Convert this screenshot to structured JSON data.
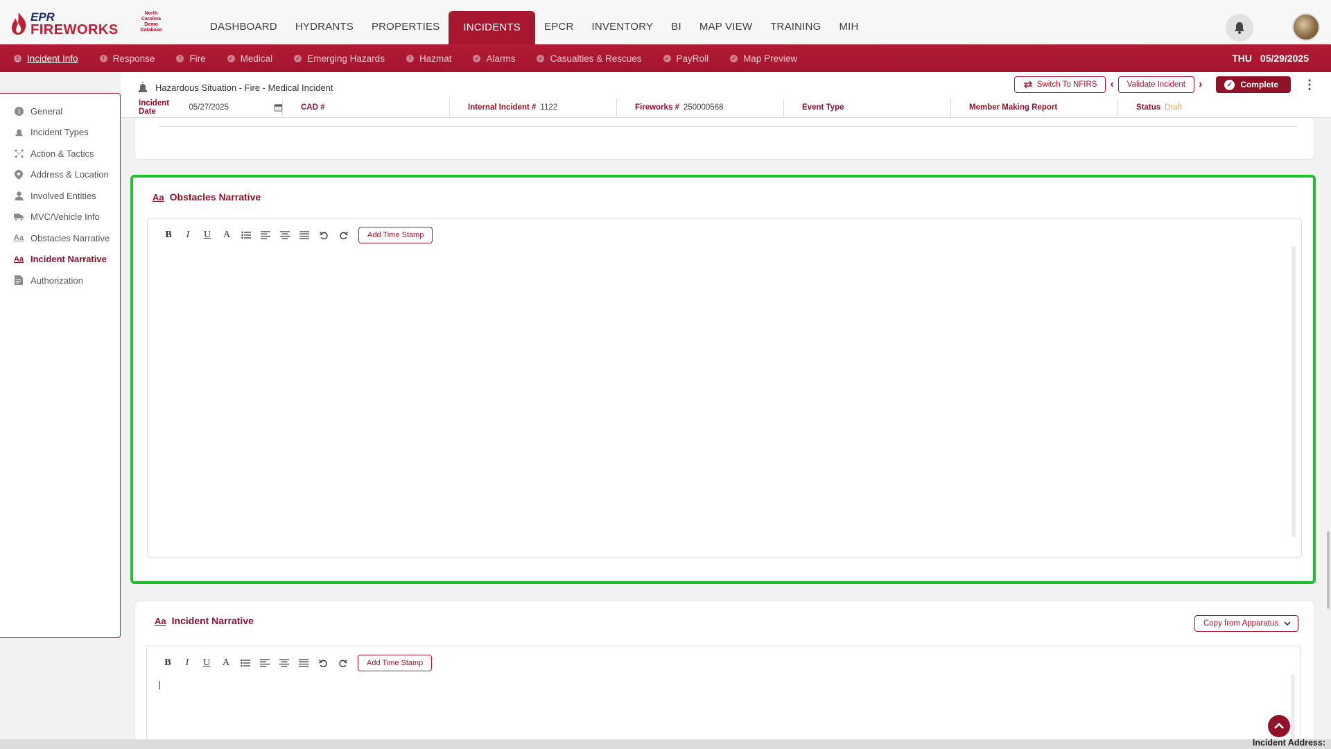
{
  "brand": {
    "logo_line1": "EPR",
    "logo_line2": "FIREWORKS",
    "org_badge": [
      "North",
      "Carolina",
      "Demo",
      "Database"
    ]
  },
  "main_nav": [
    "DASHBOARD",
    "HYDRANTS",
    "PROPERTIES",
    "INCIDENTS",
    "EPCR",
    "INVENTORY",
    "BI",
    "MAP VIEW",
    "TRAINING",
    "MIH"
  ],
  "main_nav_active": "INCIDENTS",
  "sub_nav": {
    "items": [
      {
        "label": "Incident Info",
        "status": "alert"
      },
      {
        "label": "Response",
        "status": "alert"
      },
      {
        "label": "Fire",
        "status": "alert"
      },
      {
        "label": "Medical",
        "status": "check"
      },
      {
        "label": "Emerging Hazards",
        "status": "check"
      },
      {
        "label": "Hazmat",
        "status": "alert"
      },
      {
        "label": "Alarms",
        "status": "check"
      },
      {
        "label": "Casualties & Rescues",
        "status": "check"
      },
      {
        "label": "PayRoll",
        "status": "check"
      },
      {
        "label": "Map Preview",
        "status": "check"
      }
    ],
    "day": "THU",
    "date": "05/29/2025"
  },
  "incident_header": {
    "title": "Hazardous Situation - Fire - Medical Incident",
    "switch_btn": "Switch To NFIRS",
    "validate_btn": "Validate Incident",
    "complete_btn": "Complete",
    "fields": [
      {
        "label": "Incident Date",
        "value": "05/27/2025"
      },
      {
        "label": "CAD #",
        "value": ""
      },
      {
        "label": "Internal Incident #",
        "value": "1122"
      },
      {
        "label": "Fireworks #",
        "value": "250000568"
      },
      {
        "label": "Event Type",
        "value": ""
      },
      {
        "label": "Member Making Report",
        "value": ""
      },
      {
        "label": "Status",
        "value": "Draft"
      }
    ]
  },
  "left_menu": {
    "items": [
      {
        "label": "General",
        "icon": "info-icon"
      },
      {
        "label": "Incident Types",
        "icon": "siren-icon"
      },
      {
        "label": "Action & Tactics",
        "icon": "tactics-icon"
      },
      {
        "label": "Address & Location",
        "icon": "map-pin-icon"
      },
      {
        "label": "Involved Entities",
        "icon": "person-icon"
      },
      {
        "label": "MVC/Vehicle Info",
        "icon": "truck-icon"
      },
      {
        "label": "Obstacles Narrative",
        "icon": "text-icon"
      },
      {
        "label": "Incident Narrative",
        "icon": "text-icon"
      },
      {
        "label": "Authorization",
        "icon": "document-icon"
      }
    ],
    "active": "Incident Narrative"
  },
  "obstacles": {
    "title": "Obstacles Narrative",
    "timestamp_btn": "Add Time Stamp",
    "text": ""
  },
  "narrative": {
    "title": "Incident Narrative",
    "copy_btn": "Copy from Apparatus",
    "timestamp_btn": "Add Time Stamp",
    "text": ""
  },
  "toolbar": {
    "bold": "B",
    "italic": "I",
    "underline": "U",
    "color": "A"
  },
  "footer": {
    "address_label": "Incident Address:"
  },
  "colors": {
    "brand": "#a8162f",
    "highlight": "#1dc12a",
    "draft": "#f0a24a"
  }
}
